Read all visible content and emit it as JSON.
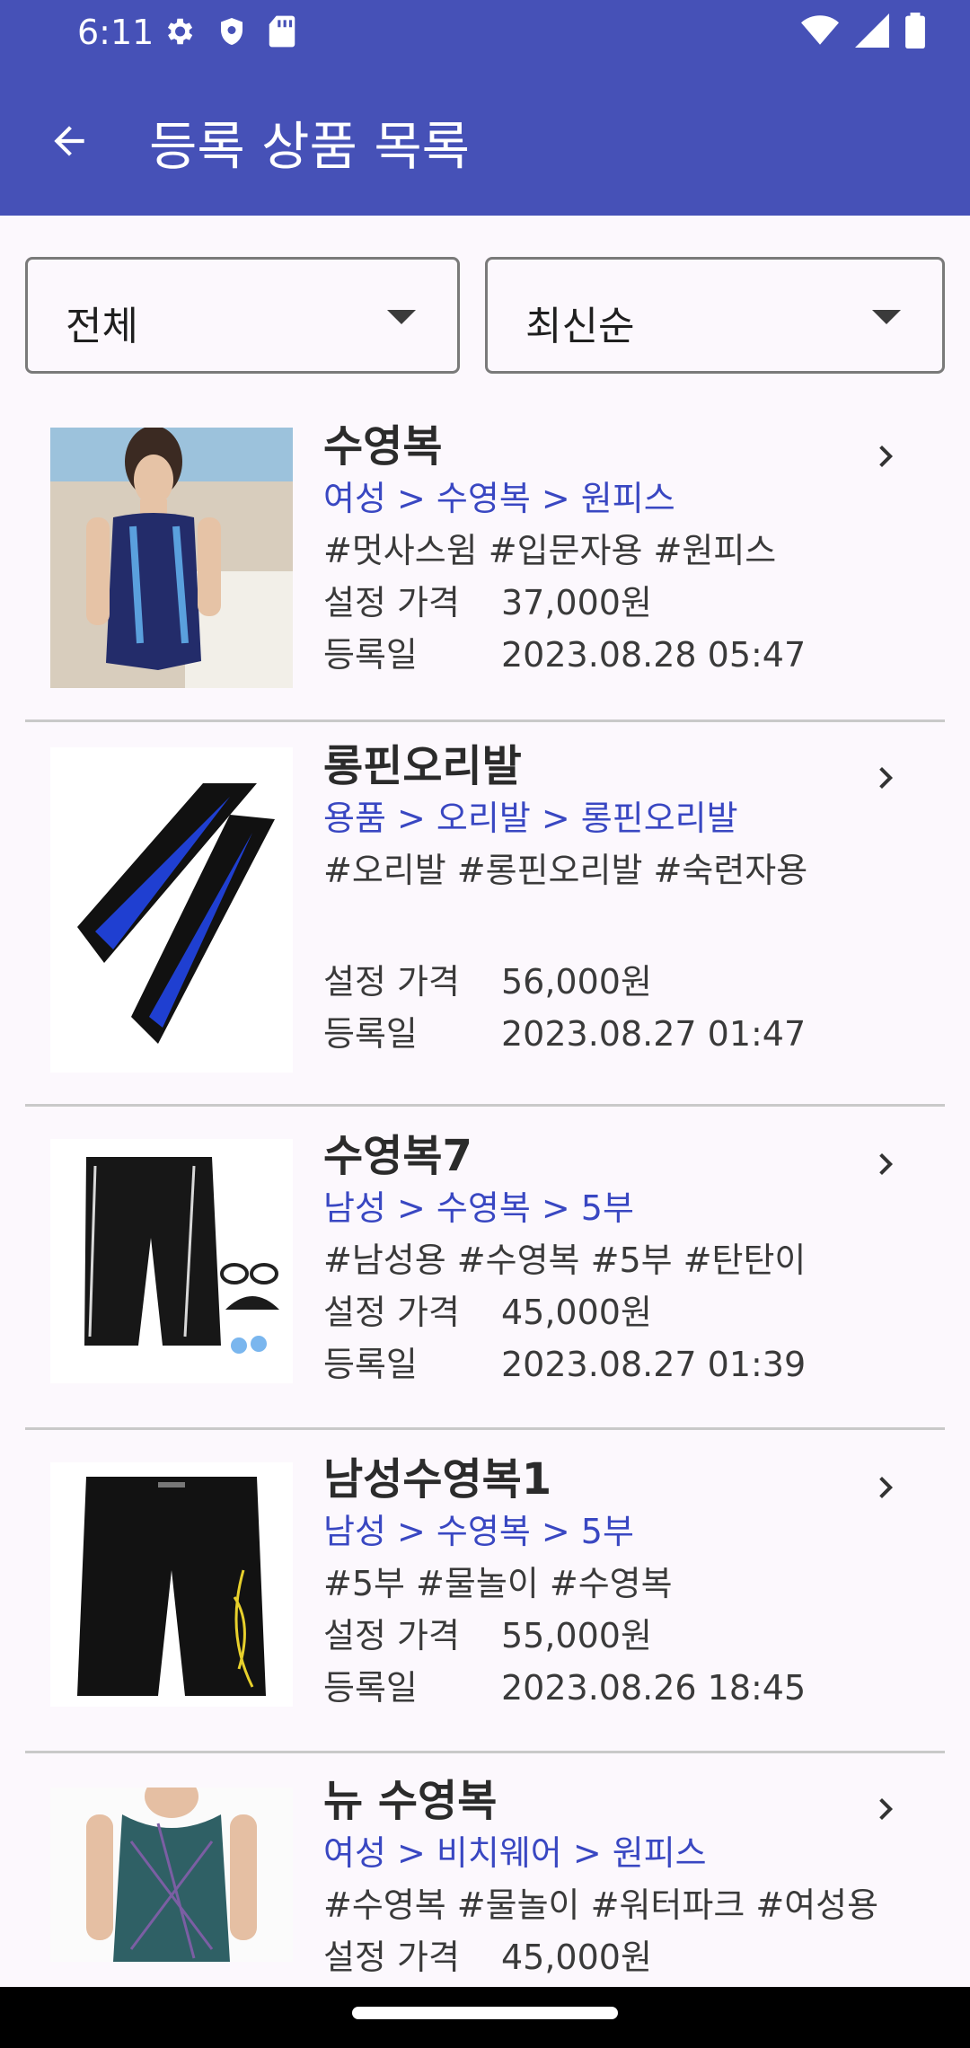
{
  "status": {
    "time": "6:11",
    "left_icons": [
      "settings-icon",
      "shield-icon",
      "sd-card-icon"
    ],
    "right_icons": [
      "wifi-icon",
      "cell-signal-icon",
      "battery-icon"
    ]
  },
  "appbar": {
    "title": "등록 상품 목록",
    "back_icon": "arrow-back-icon",
    "bg": "#4651b7"
  },
  "filters": {
    "category": "전체",
    "sort": "최신순"
  },
  "products": [
    {
      "name": "수영복",
      "category": "여성 > 수영복 > 원피스",
      "tags": "#멋사스윔 #입문자용 #원피스",
      "price_label": "설정 가격",
      "price": "37,000원",
      "date_label": "등록일",
      "date": "2023.08.28 05:47"
    },
    {
      "name": "롱핀오리발",
      "category": "용품 > 오리발 > 롱핀오리발",
      "tags": "#오리발 #롱핀오리발 #숙련자용",
      "price_label": "설정 가격",
      "price": "56,000원",
      "date_label": "등록일",
      "date": "2023.08.27 01:47"
    },
    {
      "name": "수영복7",
      "category": "남성 > 수영복 > 5부",
      "tags": "#남성용 #수영복 #5부 #탄탄이",
      "price_label": "설정 가격",
      "price": "45,000원",
      "date_label": "등록일",
      "date": "2023.08.27 01:39"
    },
    {
      "name": "남성수영복1",
      "category": "남성 > 수영복 > 5부",
      "tags": "#5부 #물놀이 #수영복",
      "price_label": "설정 가격",
      "price": "55,000원",
      "date_label": "등록일",
      "date": "2023.08.26 18:45"
    },
    {
      "name": "뉴 수영복",
      "category": "여성 > 비치웨어 > 원피스",
      "tags": "#수영복 #물놀이 #워터파크 #여성용",
      "price_label": "설정 가격",
      "price": "45,000원"
    }
  ],
  "colors": {
    "accent": "#3947c2",
    "appbar": "#4651b7"
  }
}
